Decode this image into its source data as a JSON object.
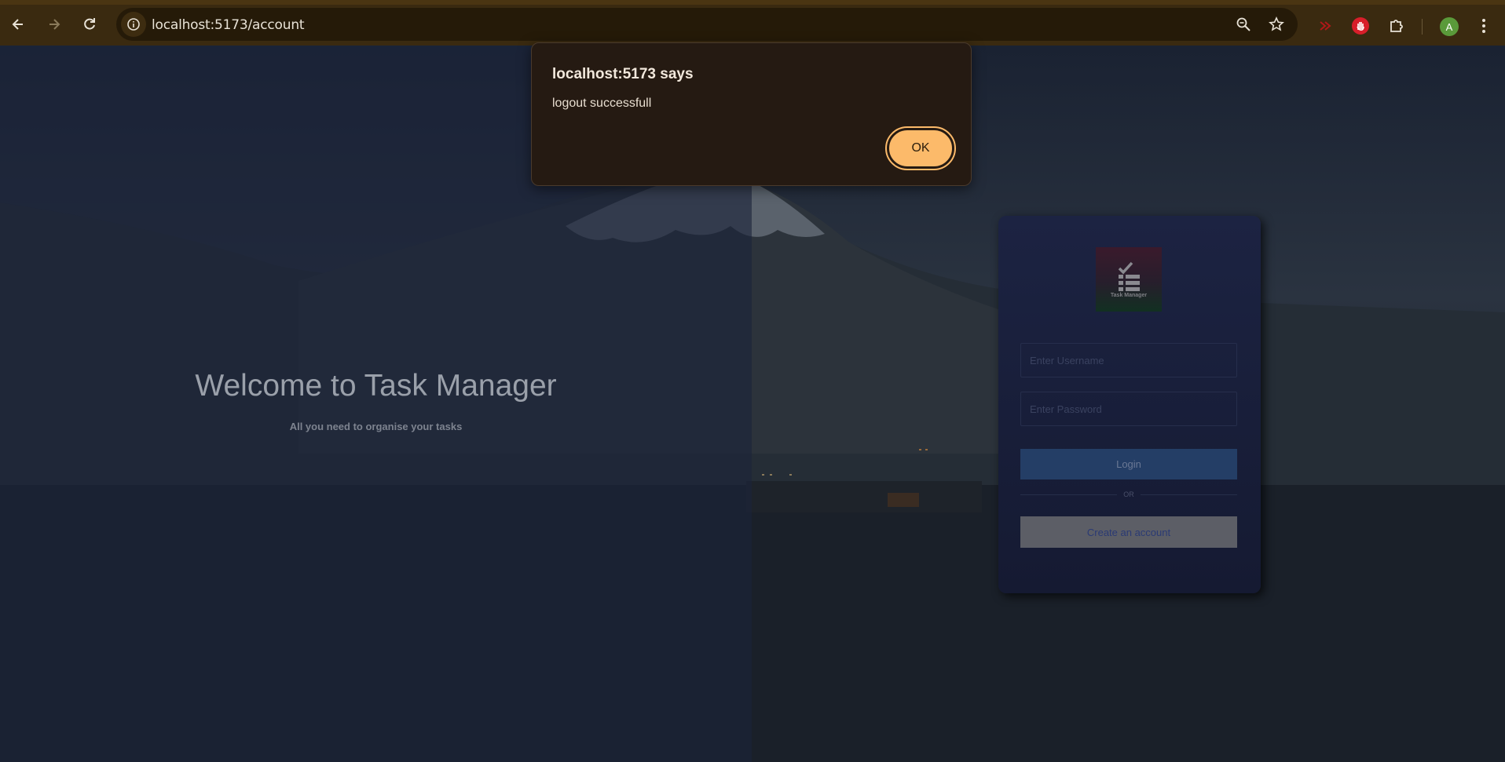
{
  "browser": {
    "url": "localhost:5173/account",
    "profile_initial": "A",
    "icons": [
      "back-icon",
      "forward-icon",
      "reload-icon",
      "site-info-icon",
      "zoom-icon",
      "bookmark-star-icon",
      "extension-red-icon",
      "extension-hand-icon",
      "extensions-puzzle-icon",
      "menu-dots-icon"
    ]
  },
  "dialog": {
    "title": "localhost:5173 says",
    "message": "logout successfull",
    "ok_label": "OK"
  },
  "hero": {
    "title": "Welcome to Task Manager",
    "subtitle": "All you need to organise your tasks"
  },
  "login_card": {
    "logo_text": "Task Manager",
    "username_placeholder": "Enter Username",
    "password_placeholder": "Enter Password",
    "login_label": "Login",
    "or_label": "OR",
    "create_label": "Create an account"
  },
  "colors": {
    "chrome_bg": "#3a2a10",
    "ok_button": "#fcba6a",
    "login_button": "#243e66",
    "card_bg": "#1c2342"
  }
}
